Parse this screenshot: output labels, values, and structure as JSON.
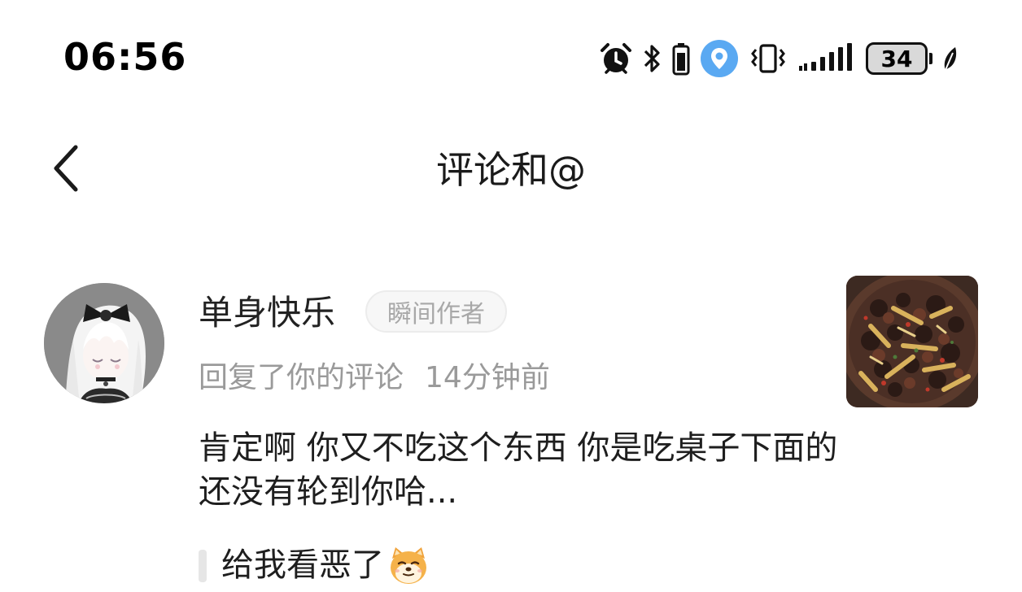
{
  "status_bar": {
    "time": "06:56",
    "battery_level": "34",
    "icons": [
      "alarm-icon",
      "bluetooth-icon",
      "battery-small-icon",
      "location-icon",
      "vibrate-icon",
      "signal-icon",
      "battery-icon",
      "leaf-icon"
    ]
  },
  "header": {
    "back_icon": "chevron-left-icon",
    "title": "评论和@"
  },
  "notification": {
    "username": "单身快乐",
    "badge": "瞬间作者",
    "action": "回复了你的评论",
    "time": "14分钟前",
    "reply": "肯定啊 你又不吃这个东西 你是吃桌子下面的 还没有轮到你哈...",
    "quoted_comment": "给我看恶了",
    "quoted_emoji": "shiba-dog-emoji"
  },
  "colors": {
    "location_blue": "#5aa9f2",
    "meta_gray": "#9a9a9a",
    "badge_gray": "#a8a8a8"
  }
}
